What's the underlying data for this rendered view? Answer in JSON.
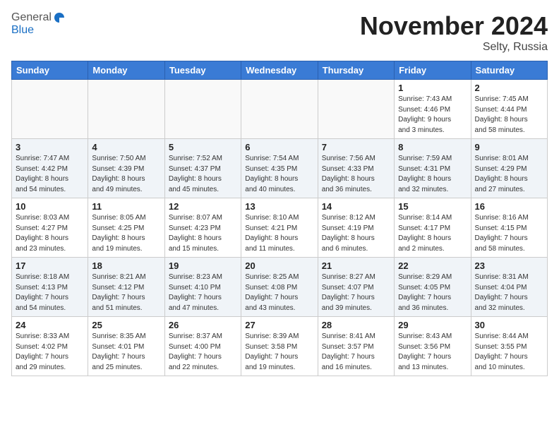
{
  "header": {
    "logo_general": "General",
    "logo_blue": "Blue",
    "month_title": "November 2024",
    "location": "Selty, Russia"
  },
  "days_of_week": [
    "Sunday",
    "Monday",
    "Tuesday",
    "Wednesday",
    "Thursday",
    "Friday",
    "Saturday"
  ],
  "weeks": [
    [
      {
        "day": "",
        "info": ""
      },
      {
        "day": "",
        "info": ""
      },
      {
        "day": "",
        "info": ""
      },
      {
        "day": "",
        "info": ""
      },
      {
        "day": "",
        "info": ""
      },
      {
        "day": "1",
        "info": "Sunrise: 7:43 AM\nSunset: 4:46 PM\nDaylight: 9 hours\nand 3 minutes."
      },
      {
        "day": "2",
        "info": "Sunrise: 7:45 AM\nSunset: 4:44 PM\nDaylight: 8 hours\nand 58 minutes."
      }
    ],
    [
      {
        "day": "3",
        "info": "Sunrise: 7:47 AM\nSunset: 4:42 PM\nDaylight: 8 hours\nand 54 minutes."
      },
      {
        "day": "4",
        "info": "Sunrise: 7:50 AM\nSunset: 4:39 PM\nDaylight: 8 hours\nand 49 minutes."
      },
      {
        "day": "5",
        "info": "Sunrise: 7:52 AM\nSunset: 4:37 PM\nDaylight: 8 hours\nand 45 minutes."
      },
      {
        "day": "6",
        "info": "Sunrise: 7:54 AM\nSunset: 4:35 PM\nDaylight: 8 hours\nand 40 minutes."
      },
      {
        "day": "7",
        "info": "Sunrise: 7:56 AM\nSunset: 4:33 PM\nDaylight: 8 hours\nand 36 minutes."
      },
      {
        "day": "8",
        "info": "Sunrise: 7:59 AM\nSunset: 4:31 PM\nDaylight: 8 hours\nand 32 minutes."
      },
      {
        "day": "9",
        "info": "Sunrise: 8:01 AM\nSunset: 4:29 PM\nDaylight: 8 hours\nand 27 minutes."
      }
    ],
    [
      {
        "day": "10",
        "info": "Sunrise: 8:03 AM\nSunset: 4:27 PM\nDaylight: 8 hours\nand 23 minutes."
      },
      {
        "day": "11",
        "info": "Sunrise: 8:05 AM\nSunset: 4:25 PM\nDaylight: 8 hours\nand 19 minutes."
      },
      {
        "day": "12",
        "info": "Sunrise: 8:07 AM\nSunset: 4:23 PM\nDaylight: 8 hours\nand 15 minutes."
      },
      {
        "day": "13",
        "info": "Sunrise: 8:10 AM\nSunset: 4:21 PM\nDaylight: 8 hours\nand 11 minutes."
      },
      {
        "day": "14",
        "info": "Sunrise: 8:12 AM\nSunset: 4:19 PM\nDaylight: 8 hours\nand 6 minutes."
      },
      {
        "day": "15",
        "info": "Sunrise: 8:14 AM\nSunset: 4:17 PM\nDaylight: 8 hours\nand 2 minutes."
      },
      {
        "day": "16",
        "info": "Sunrise: 8:16 AM\nSunset: 4:15 PM\nDaylight: 7 hours\nand 58 minutes."
      }
    ],
    [
      {
        "day": "17",
        "info": "Sunrise: 8:18 AM\nSunset: 4:13 PM\nDaylight: 7 hours\nand 54 minutes."
      },
      {
        "day": "18",
        "info": "Sunrise: 8:21 AM\nSunset: 4:12 PM\nDaylight: 7 hours\nand 51 minutes."
      },
      {
        "day": "19",
        "info": "Sunrise: 8:23 AM\nSunset: 4:10 PM\nDaylight: 7 hours\nand 47 minutes."
      },
      {
        "day": "20",
        "info": "Sunrise: 8:25 AM\nSunset: 4:08 PM\nDaylight: 7 hours\nand 43 minutes."
      },
      {
        "day": "21",
        "info": "Sunrise: 8:27 AM\nSunset: 4:07 PM\nDaylight: 7 hours\nand 39 minutes."
      },
      {
        "day": "22",
        "info": "Sunrise: 8:29 AM\nSunset: 4:05 PM\nDaylight: 7 hours\nand 36 minutes."
      },
      {
        "day": "23",
        "info": "Sunrise: 8:31 AM\nSunset: 4:04 PM\nDaylight: 7 hours\nand 32 minutes."
      }
    ],
    [
      {
        "day": "24",
        "info": "Sunrise: 8:33 AM\nSunset: 4:02 PM\nDaylight: 7 hours\nand 29 minutes."
      },
      {
        "day": "25",
        "info": "Sunrise: 8:35 AM\nSunset: 4:01 PM\nDaylight: 7 hours\nand 25 minutes."
      },
      {
        "day": "26",
        "info": "Sunrise: 8:37 AM\nSunset: 4:00 PM\nDaylight: 7 hours\nand 22 minutes."
      },
      {
        "day": "27",
        "info": "Sunrise: 8:39 AM\nSunset: 3:58 PM\nDaylight: 7 hours\nand 19 minutes."
      },
      {
        "day": "28",
        "info": "Sunrise: 8:41 AM\nSunset: 3:57 PM\nDaylight: 7 hours\nand 16 minutes."
      },
      {
        "day": "29",
        "info": "Sunrise: 8:43 AM\nSunset: 3:56 PM\nDaylight: 7 hours\nand 13 minutes."
      },
      {
        "day": "30",
        "info": "Sunrise: 8:44 AM\nSunset: 3:55 PM\nDaylight: 7 hours\nand 10 minutes."
      }
    ]
  ]
}
